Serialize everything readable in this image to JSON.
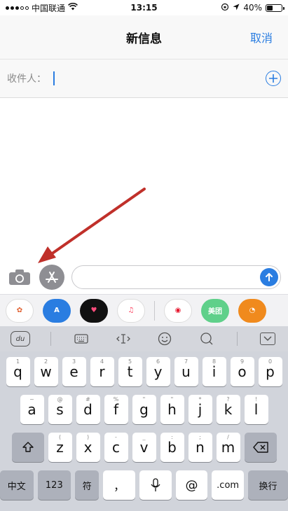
{
  "status": {
    "carrier": "中国联通",
    "time": "13:15",
    "battery": "40%",
    "battery_level": 0.4
  },
  "nav": {
    "title": "新信息",
    "cancel": "取消"
  },
  "recipient": {
    "label": "收件人："
  },
  "apps": [
    {
      "name": "photos-app-icon",
      "bg": "#ffffff",
      "glyph": "✿",
      "color": "#e06030"
    },
    {
      "name": "appstore-app-icon",
      "bg": "#2a7de1",
      "glyph": "A",
      "color": "#ffffff"
    },
    {
      "name": "digital-touch-app-icon",
      "bg": "#111111",
      "glyph": "♥",
      "color": "#ff4d7d"
    },
    {
      "name": "music-app-icon",
      "bg": "#ffffff",
      "glyph": "♫",
      "color": "#fc3c5a"
    },
    {
      "name": "weibo-app-icon",
      "bg": "#ffffff",
      "glyph": "◉",
      "color": "#e6162d"
    },
    {
      "name": "meituan-app-icon",
      "bg": "#5fd08a",
      "glyph": "美团",
      "color": "#ffffff"
    },
    {
      "name": "uc-browser-app-icon",
      "bg": "#f08a1d",
      "glyph": "◔",
      "color": "#ffffff"
    }
  ],
  "toolbar": {
    "du": "du"
  },
  "keyboard": {
    "row1": [
      {
        "key": "q",
        "hint": "1"
      },
      {
        "key": "w",
        "hint": "2"
      },
      {
        "key": "e",
        "hint": "3"
      },
      {
        "key": "r",
        "hint": "4"
      },
      {
        "key": "t",
        "hint": "5"
      },
      {
        "key": "y",
        "hint": "6"
      },
      {
        "key": "u",
        "hint": "7"
      },
      {
        "key": "i",
        "hint": "8"
      },
      {
        "key": "o",
        "hint": "9"
      },
      {
        "key": "p",
        "hint": "0"
      }
    ],
    "row2": [
      {
        "key": "a",
        "hint": "~"
      },
      {
        "key": "s",
        "hint": "@"
      },
      {
        "key": "d",
        "hint": "#"
      },
      {
        "key": "f",
        "hint": "%"
      },
      {
        "key": "g",
        "hint": "\""
      },
      {
        "key": "h",
        "hint": "\""
      },
      {
        "key": "j",
        "hint": "*"
      },
      {
        "key": "k",
        "hint": "?"
      },
      {
        "key": "l",
        "hint": "!"
      }
    ],
    "row3": [
      {
        "key": "z",
        "hint": "("
      },
      {
        "key": "x",
        "hint": ")"
      },
      {
        "key": "c",
        "hint": "-"
      },
      {
        "key": "v",
        "hint": "_"
      },
      {
        "key": "b",
        "hint": ":"
      },
      {
        "key": "n",
        "hint": ";"
      },
      {
        "key": "m",
        "hint": "/"
      }
    ],
    "row4": {
      "zh": "中文",
      "num": "123",
      "sym": "符",
      "comma": "，",
      "at": "@",
      "dotcom": ".com",
      "ret": "换行"
    }
  }
}
